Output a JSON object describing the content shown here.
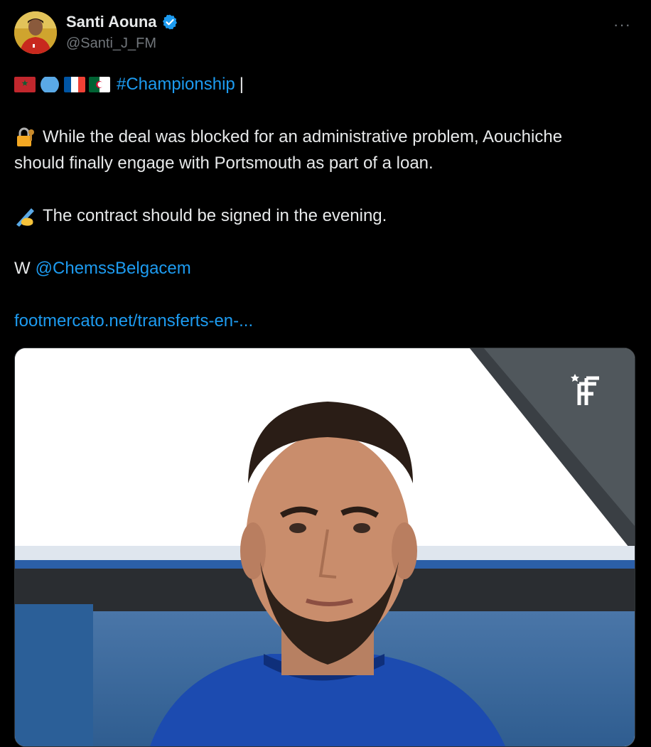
{
  "author": {
    "name": "Santi Aouna",
    "handle": "@Santi_J_FM"
  },
  "menu": {
    "more_label": "···"
  },
  "tweet": {
    "hashtag": "#Championship",
    "separator": "|",
    "line1": "While the deal was blocked for an administrative problem, Aouchiche",
    "line2": "should finally engage with Portsmouth as part of a loan.",
    "line3": "The contract should be signed in the evening.",
    "credit_prefix": "W",
    "mention": "@ChemssBelgacem",
    "url": "footmercato.net/transferts-en-..."
  },
  "icons": {
    "lock": "locked-with-key-icon",
    "write": "writing-hand-icon",
    "verified": "verified-badge-icon"
  },
  "colors": {
    "background": "#000000",
    "text": "#e7e9ea",
    "muted": "#71767b",
    "link": "#1d9bf0",
    "verified": "#1d9bf0"
  }
}
